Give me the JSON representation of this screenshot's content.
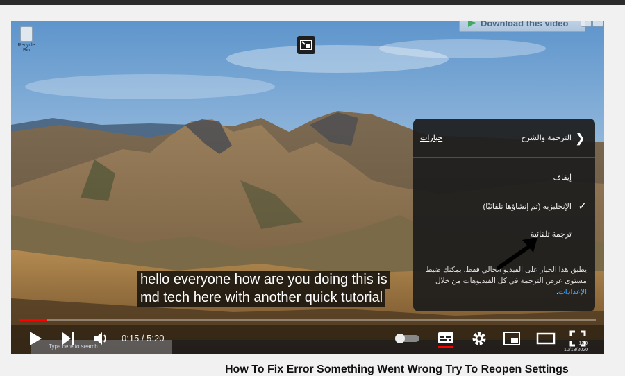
{
  "player": {
    "captions": {
      "line1": "hello everyone how are you doing this is",
      "line2": "md tech here with another quick tutorial"
    },
    "progress": {
      "current": "0:15",
      "duration": "5:20",
      "time_display": "0:15 / 5:20",
      "fraction": 0.047
    },
    "desktop_icon_label": "Recycle Bin",
    "taskbar": {
      "search_placeholder": "Type here to search",
      "clock": "12:0",
      "date": "10/18/2020"
    }
  },
  "download_bar": {
    "label": "Download this video",
    "help": "?",
    "close": "×"
  },
  "subtitle_menu": {
    "title": "الترجمة والشرح",
    "options_link": "خيارات",
    "items": [
      {
        "label": "إيقاف",
        "checked": false
      },
      {
        "label": "الإنجليزية (تم إنشاؤها تلقائيًا)",
        "checked": true
      },
      {
        "label": "ترجمة تلقائية",
        "checked": false
      }
    ],
    "note": "يطبق هذا الخيار على الفيديو الحالي فقط. يمكنك ضبط مستوى عرض الترجمة في كل الفيديوهات من خلال",
    "note_link": "الإعدادات",
    "note_end": "."
  },
  "page": {
    "video_title": "How To Fix Error Something Went Wrong Try To Reopen Settings"
  },
  "icons": {
    "play": "play-icon",
    "next": "next-icon",
    "volume": "volume-icon",
    "autoplay": "autoplay-toggle-icon",
    "subtitles": "subtitles-icon",
    "settings": "gear-icon",
    "miniplayer": "miniplayer-icon",
    "theater": "theater-icon",
    "fullscreen": "fullscreen-icon"
  },
  "colors": {
    "accent": "#ff0000",
    "link": "#3ea6ff",
    "panel_bg": "#1c1c1c"
  }
}
